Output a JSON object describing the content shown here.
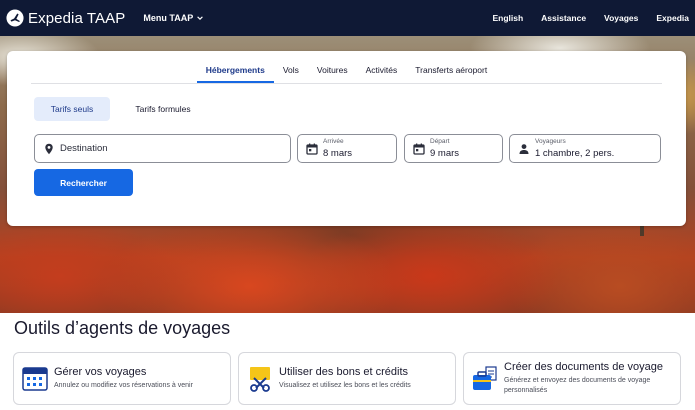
{
  "header": {
    "brand": "Expedia TAAP",
    "menu_label": "Menu TAAP",
    "links": [
      "English",
      "Assistance",
      "Voyages",
      "Expedia"
    ]
  },
  "search": {
    "tabs": [
      {
        "label": "Hébergements",
        "active": true
      },
      {
        "label": "Vols",
        "active": false
      },
      {
        "label": "Voitures",
        "active": false
      },
      {
        "label": "Activités",
        "active": false
      },
      {
        "label": "Transferts aéroport",
        "active": false
      }
    ],
    "fare_types": {
      "selected": "Tarifs seuls",
      "other": "Tarifs formules"
    },
    "destination": {
      "placeholder": "Destination"
    },
    "arrival": {
      "label": "Arrivée",
      "value": "8 mars"
    },
    "departure": {
      "label": "Départ",
      "value": "9 mars"
    },
    "travelers": {
      "label": "Voyageurs",
      "value": "1 chambre, 2 pers."
    },
    "submit_label": "Rechercher"
  },
  "tools": {
    "title": "Outils d’agents de voyages",
    "cards": [
      {
        "title": "Gérer vos voyages",
        "description": [
          "Annulez ou modifiez vos réservations à venir"
        ],
        "icon": "calendar-grid-icon"
      },
      {
        "title": "Utiliser des bons et crédits",
        "description": [
          "Visualisez et utilisez les bons et les crédits"
        ],
        "icon": "ticket-scissors-icon"
      },
      {
        "title": "Créer des documents de voyage",
        "description": [
          "Générez et envoyez des documents de voyage",
          "personnalisés"
        ],
        "icon": "suitcase-document-icon"
      }
    ]
  },
  "colors": {
    "nav_bg": "#0f1935",
    "primary": "#1668e3",
    "selected_pill": "#e4ecfb"
  }
}
